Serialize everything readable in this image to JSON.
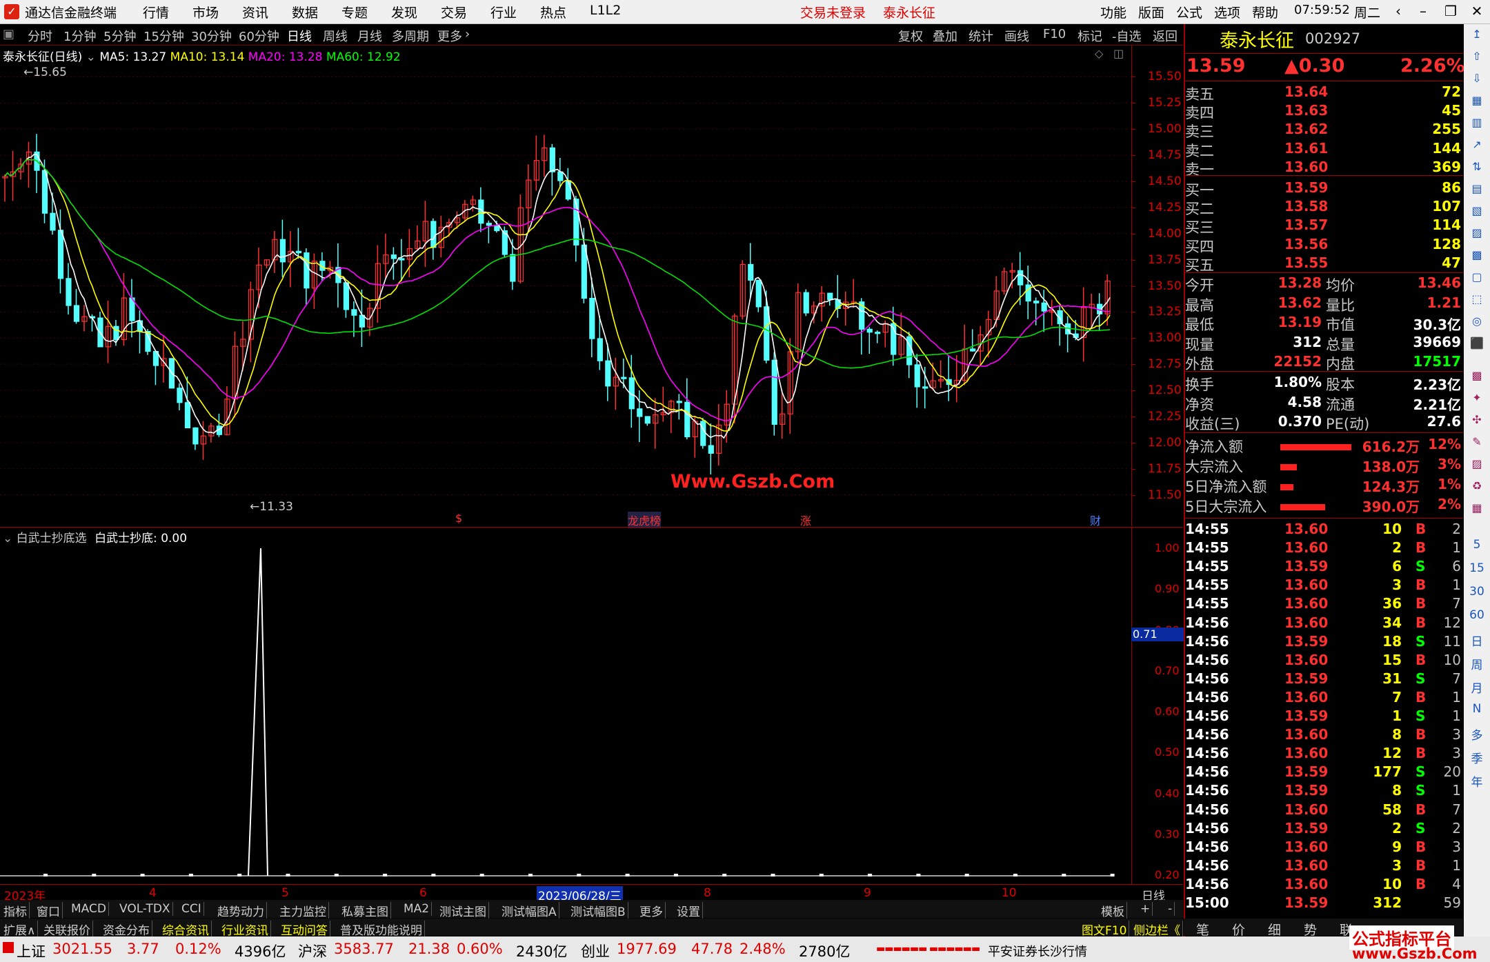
{
  "window": {
    "app_title": "通达信金融终端",
    "menus": [
      "行情",
      "市场",
      "资讯",
      "数据",
      "专题",
      "发现",
      "交易",
      "行业",
      "热点",
      "L1L2"
    ],
    "login_status": "交易未登录",
    "stock_title": "泰永长征",
    "right_menus": [
      "功能",
      "版面",
      "公式",
      "选项",
      "帮助"
    ],
    "clock": "07:59:52",
    "weekday": "周二"
  },
  "period_bar": {
    "items": [
      "分时",
      "1分钟",
      "5分钟",
      "15分钟",
      "30分钟",
      "60分钟",
      "日线",
      "周线",
      "月线",
      "多周期",
      "更多"
    ],
    "active": "日线",
    "right_buttons": [
      "复权",
      "叠加",
      "统计",
      "画线",
      "F10",
      "标记",
      "-自选",
      "返回"
    ]
  },
  "main_chart": {
    "title": "泰永长征(日线)",
    "ma_legend": [
      {
        "label": "MA5: 13.27",
        "color": "#ffffff"
      },
      {
        "label": "MA10: 13.14",
        "color": "#ffff00"
      },
      {
        "label": "MA20: 13.28",
        "color": "#ff00ff"
      },
      {
        "label": "MA60: 12.92",
        "color": "#00ff00"
      }
    ],
    "high_label": "15.65",
    "low_label": "11.33",
    "watermark": "Www.Gszb.Com",
    "markers": [
      {
        "text": "$",
        "color": "#ff3030"
      },
      {
        "text": "龙虎榜",
        "color": "#ff3030"
      },
      {
        "text": "涨",
        "color": "#ff3030"
      },
      {
        "text": "财",
        "color": "#5080ff"
      }
    ],
    "price_ticks": [
      "15.50",
      "15.25",
      "15.00",
      "14.75",
      "14.50",
      "14.25",
      "14.00",
      "13.75",
      "13.50",
      "13.25",
      "13.00",
      "12.75",
      "12.50",
      "12.25",
      "12.00",
      "11.75",
      "11.50"
    ]
  },
  "sub_chart": {
    "title": "白武士抄底选",
    "value_label": "白武士抄底: 0.00",
    "ticks": [
      "1.00",
      "0.90",
      "0.80",
      "0.70",
      "0.60",
      "0.50",
      "0.40",
      "0.30",
      "0.20"
    ],
    "cursor_value": "0.71"
  },
  "date_axis": {
    "labels": [
      "2023年",
      "4",
      "5",
      "6",
      "2023/06/28/三",
      "8",
      "9",
      "10"
    ],
    "period": "日线"
  },
  "chart_data": {
    "type": "line",
    "title": "泰永长征(日线)",
    "ylim": [
      11.2,
      15.8
    ],
    "series": [
      {
        "name": "MA5",
        "values": [
          13.27
        ]
      },
      {
        "name": "MA10",
        "values": [
          13.14
        ]
      },
      {
        "name": "MA20",
        "values": [
          13.28
        ]
      },
      {
        "name": "MA60",
        "values": [
          12.92
        ]
      }
    ],
    "high": 15.65,
    "low": 11.33
  },
  "tabs_row1": [
    "指标",
    "窗口",
    "MACD",
    "VOL-TDX",
    "CCI",
    "趋势动力",
    "主力监控",
    "私募主图",
    "MA2",
    "测试主图",
    "测试幅图A",
    "测试幅图B",
    "更多",
    "设置"
  ],
  "tabs_row1_right": [
    "模板",
    "+",
    "-"
  ],
  "tabs_row2": [
    "扩展∧",
    "关联报价",
    "资金分布",
    "综合资讯",
    "行业资讯",
    "互动问答",
    "普及版功能说明"
  ],
  "tabs_row2_right": [
    "图文F10",
    "侧边栏《"
  ],
  "quote": {
    "name": "泰永长征",
    "code": "002927",
    "price": "13.59",
    "change": "▲0.30",
    "change_pct": "2.26%",
    "asks": [
      {
        "label": "卖五",
        "price": "13.64",
        "vol": "72"
      },
      {
        "label": "卖四",
        "price": "13.63",
        "vol": "45"
      },
      {
        "label": "卖三",
        "price": "13.62",
        "vol": "255"
      },
      {
        "label": "卖二",
        "price": "13.61",
        "vol": "144"
      },
      {
        "label": "卖一",
        "price": "13.60",
        "vol": "369"
      }
    ],
    "bids": [
      {
        "label": "买一",
        "price": "13.59",
        "vol": "86"
      },
      {
        "label": "买二",
        "price": "13.58",
        "vol": "107"
      },
      {
        "label": "买三",
        "price": "13.57",
        "vol": "114"
      },
      {
        "label": "买四",
        "price": "13.56",
        "vol": "128"
      },
      {
        "label": "买五",
        "price": "13.55",
        "vol": "47"
      }
    ],
    "stats": [
      {
        "l1": "今开",
        "v1": "13.28",
        "c1": "#ff3030",
        "l2": "均价",
        "v2": "13.46",
        "c2": "#ff3030"
      },
      {
        "l1": "最高",
        "v1": "13.62",
        "c1": "#ff3030",
        "l2": "量比",
        "v2": "1.21",
        "c2": "#ff3030"
      },
      {
        "l1": "最低",
        "v1": "13.19",
        "c1": "#ff3030",
        "l2": "市值",
        "v2": "30.3亿",
        "c2": "#ffffff"
      },
      {
        "l1": "现量",
        "v1": "312",
        "c1": "#ffffff",
        "l2": "总量",
        "v2": "39669",
        "c2": "#ffffff"
      },
      {
        "l1": "外盘",
        "v1": "22152",
        "c1": "#ff3030",
        "l2": "内盘",
        "v2": "17517",
        "c2": "#00ff00"
      }
    ],
    "stats2": [
      {
        "l1": "换手",
        "v1": "1.80%",
        "l2": "股本",
        "v2": "2.23亿"
      },
      {
        "l1": "净资",
        "v1": "4.58",
        "l2": "流通",
        "v2": "2.21亿"
      },
      {
        "l1": "收益(三)",
        "v1": "0.370",
        "l2": "PE(动)",
        "v2": "27.6"
      }
    ],
    "flows": [
      {
        "label": "净流入额",
        "value": "616.2万",
        "pct": "12%",
        "bar": 0.95
      },
      {
        "label": "大宗流入",
        "value": "138.0万",
        "pct": "3%",
        "bar": 0.22
      },
      {
        "label": "5日净流入额",
        "value": "124.3万",
        "pct": "1%",
        "bar": 0.18
      },
      {
        "label": "5日大宗流入",
        "value": "390.0万",
        "pct": "2%",
        "bar": 0.6
      }
    ],
    "ticks": [
      {
        "t": "14:55",
        "p": "13.60",
        "v": "10",
        "s": "B",
        "n": "2"
      },
      {
        "t": "14:55",
        "p": "13.60",
        "v": "2",
        "s": "B",
        "n": "1"
      },
      {
        "t": "14:55",
        "p": "13.59",
        "v": "6",
        "s": "S",
        "n": "6"
      },
      {
        "t": "14:55",
        "p": "13.60",
        "v": "3",
        "s": "B",
        "n": "1"
      },
      {
        "t": "14:55",
        "p": "13.60",
        "v": "36",
        "s": "B",
        "n": "7"
      },
      {
        "t": "14:56",
        "p": "13.60",
        "v": "34",
        "s": "B",
        "n": "12"
      },
      {
        "t": "14:56",
        "p": "13.59",
        "v": "18",
        "s": "S",
        "n": "11"
      },
      {
        "t": "14:56",
        "p": "13.60",
        "v": "15",
        "s": "B",
        "n": "10"
      },
      {
        "t": "14:56",
        "p": "13.59",
        "v": "31",
        "s": "S",
        "n": "7"
      },
      {
        "t": "14:56",
        "p": "13.60",
        "v": "7",
        "s": "B",
        "n": "1"
      },
      {
        "t": "14:56",
        "p": "13.59",
        "v": "1",
        "s": "S",
        "n": "1"
      },
      {
        "t": "14:56",
        "p": "13.60",
        "v": "8",
        "s": "B",
        "n": "3"
      },
      {
        "t": "14:56",
        "p": "13.60",
        "v": "12",
        "s": "B",
        "n": "3"
      },
      {
        "t": "14:56",
        "p": "13.59",
        "v": "177",
        "s": "S",
        "n": "20"
      },
      {
        "t": "14:56",
        "p": "13.59",
        "v": "8",
        "s": "S",
        "n": "1"
      },
      {
        "t": "14:56",
        "p": "13.60",
        "v": "58",
        "s": "B",
        "n": "7"
      },
      {
        "t": "14:56",
        "p": "13.59",
        "v": "2",
        "s": "S",
        "n": "2"
      },
      {
        "t": "14:56",
        "p": "13.60",
        "v": "9",
        "s": "B",
        "n": "3"
      },
      {
        "t": "14:56",
        "p": "13.60",
        "v": "3",
        "s": "B",
        "n": "1"
      },
      {
        "t": "14:56",
        "p": "13.60",
        "v": "10",
        "s": "B",
        "n": "4"
      },
      {
        "t": "15:00",
        "p": "13.59",
        "v": "312",
        "s": "",
        "n": "59"
      }
    ],
    "bottom_tabs": [
      "笔",
      "价",
      "细",
      "势",
      "联"
    ]
  },
  "status_bar": {
    "indices": [
      {
        "name": "上证",
        "value": "3021.55",
        "chg": "3.77",
        "pct": "0.12%",
        "amt": "4396亿"
      },
      {
        "name": "沪深",
        "value": "3583.77",
        "chg": "21.38",
        "pct": "0.60%",
        "amt": "2430亿"
      },
      {
        "name": "创业",
        "value": "1977.69",
        "chg": "47.78",
        "pct": "2.48%",
        "amt": "2780亿"
      }
    ],
    "broker": "平安证券长沙行情",
    "brand": "公式指标平台",
    "brand_url": "www.Gszb.Com"
  },
  "side_tools": [
    "5",
    "15",
    "30",
    "60",
    "日",
    "周",
    "月",
    "N",
    "多",
    "季",
    "年"
  ]
}
